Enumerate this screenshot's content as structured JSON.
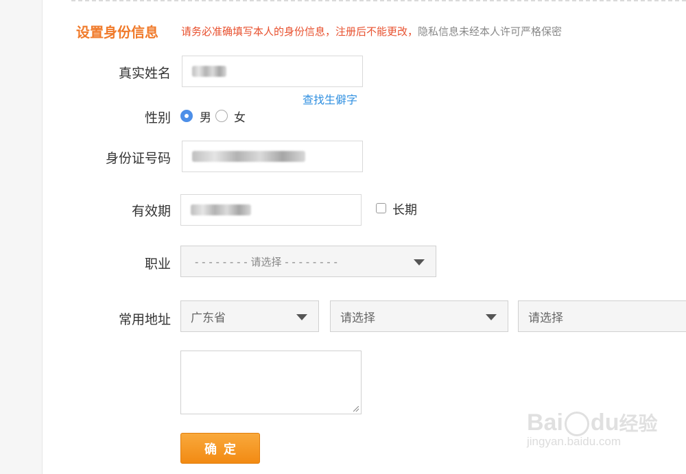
{
  "header": {
    "title": "设置身份信息",
    "notice_main": "请务必准确填写本人的身份信息，注册后不能更改，",
    "notice_privacy": "隐私信息未经本人许可严格保密"
  },
  "form": {
    "name_label": "真实姓名",
    "rare_char_link": "查找生僻字",
    "gender_label": "性别",
    "gender_male": "男",
    "gender_female": "女",
    "gender_selected": "男",
    "id_label": "身份证号码",
    "validity_label": "有效期",
    "long_term_label": "长期",
    "long_term_checked": false,
    "occupation_label": "职业",
    "occupation_placeholder": "- - - - - - - - 请选择 - - - - - - - -",
    "address_label": "常用地址",
    "province_value": "广东省",
    "city_placeholder": "请选择",
    "district_placeholder": "请选择",
    "submit_label": "确定"
  },
  "watermark": {
    "brand": "Bai",
    "brand_tail": "du",
    "brand_cn": "经验",
    "domain": "jingyan.baidu.com"
  }
}
